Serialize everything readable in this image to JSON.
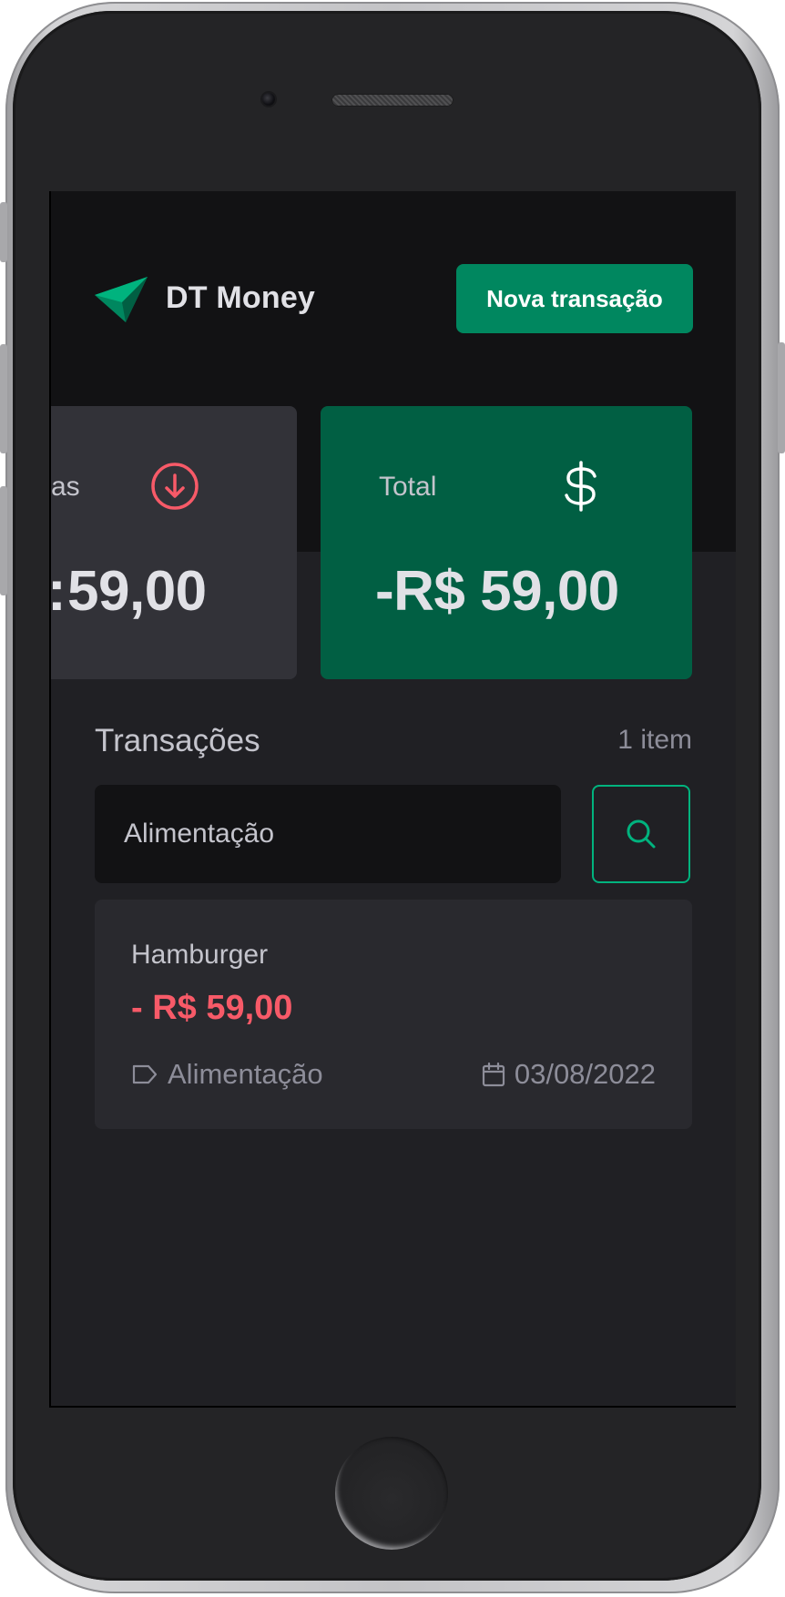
{
  "app": {
    "brand": "DT Money"
  },
  "header": {
    "new_transaction_label": "Nova transação"
  },
  "summary": {
    "outcome": {
      "label_visible": "as",
      "value_visible": "59,00",
      "icon": "arrow-circle-down-icon",
      "color": "#f75a68"
    },
    "total": {
      "label": "Total",
      "value": "-R$ 59,00",
      "icon": "currency-dollar-icon",
      "bg_color": "#015f43"
    }
  },
  "transactions": {
    "title": "Transações",
    "count": "1 item",
    "search": {
      "value": "Alimentação",
      "icon": "magnifying-glass-icon",
      "accent": "#00b37e"
    },
    "items": [
      {
        "description": "Hamburger",
        "amount": "- R$ 59,00",
        "category": "Alimentação",
        "date": "03/08/2022",
        "category_icon": "tag-icon",
        "date_icon": "calendar-icon",
        "amount_color": "#f75a68"
      }
    ]
  },
  "colors": {
    "brand_green": "#00875f",
    "background": "#202024",
    "header_bg": "#121214"
  }
}
